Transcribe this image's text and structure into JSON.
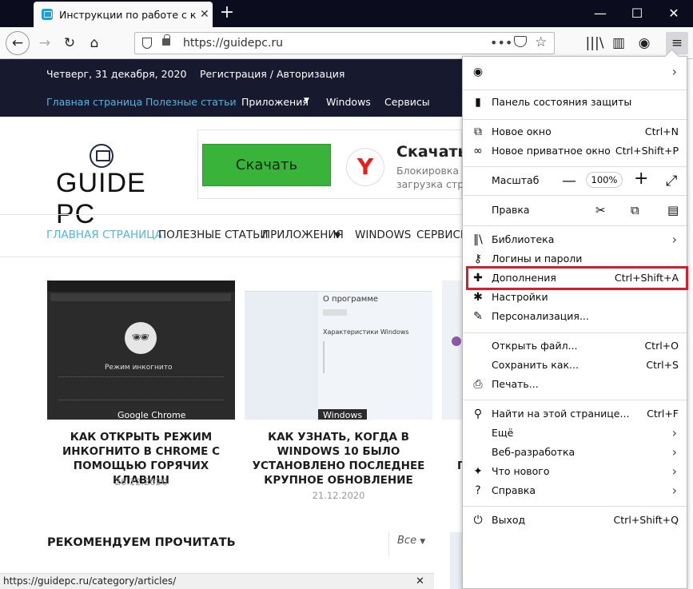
{
  "browser": {
    "tab_title": "Инструкции по работе с комп",
    "url": "https://guidepc.ru",
    "status_url": "https://guidepc.ru/category/articles/"
  },
  "site": {
    "date": "Четверг, 31 декабря, 2020",
    "auth": "Регистрация / Авторизация",
    "top_nav": [
      "Главная страница",
      "Полезные статьи",
      "Приложения",
      "Windows",
      "Сервисы"
    ],
    "logo": "GUIDE PC",
    "ad": {
      "button": "Скачать",
      "title": "Скачать",
      "line1": "Блокировка о",
      "line2": "загрузка стра"
    },
    "main_nav": [
      "ГЛАВНАЯ СТРАНИЦА",
      "ПОЛЕЗНЫЕ СТАТЬИ",
      "ПРИЛОЖЕНИЯ",
      "WINDOWS",
      "СЕРВИСЫ"
    ],
    "cards": [
      {
        "tag": "Google Chrome",
        "title": "Как открыть режим инкогнито в Chrome с помощью горячих клавиш",
        "date": "26.12.2020"
      },
      {
        "tag": "Windows",
        "title": "Как узнать, когда в Windows 10 было установлено последнее крупное обновление",
        "date": "21.12.2020"
      },
      {
        "tag": "",
        "title": "",
        "date": ""
      }
    ],
    "recommend": "РЕКОМЕНДУЕМ ПРОЧИТАТЬ",
    "filter": "Все"
  },
  "menu": {
    "protection": "Панель состояния защиты",
    "new_window": "Новое окно",
    "new_window_sc": "Ctrl+N",
    "private": "Новое приватное окно",
    "private_sc": "Ctrl+Shift+P",
    "zoom_label": "Масштаб",
    "zoom_value": "100%",
    "edit": "Правка",
    "library": "Библиотека",
    "logins": "Логины и пароли",
    "addons": "Дополнения",
    "addons_sc": "Ctrl+Shift+A",
    "settings": "Настройки",
    "customize": "Персонализация...",
    "open_file": "Открыть файл...",
    "open_file_sc": "Ctrl+O",
    "save_as": "Сохранить как...",
    "save_as_sc": "Ctrl+S",
    "print": "Печать...",
    "find": "Найти на этой странице...",
    "find_sc": "Ctrl+F",
    "more": "Ещё",
    "webdev": "Веб-разработка",
    "whatsnew": "Что нового",
    "help": "Справка",
    "exit": "Выход",
    "exit_sc": "Ctrl+Shift+Q"
  },
  "colors": {
    "accent": "#4bb8e5",
    "highlight": "#d81e2a",
    "header": "#17192e"
  }
}
